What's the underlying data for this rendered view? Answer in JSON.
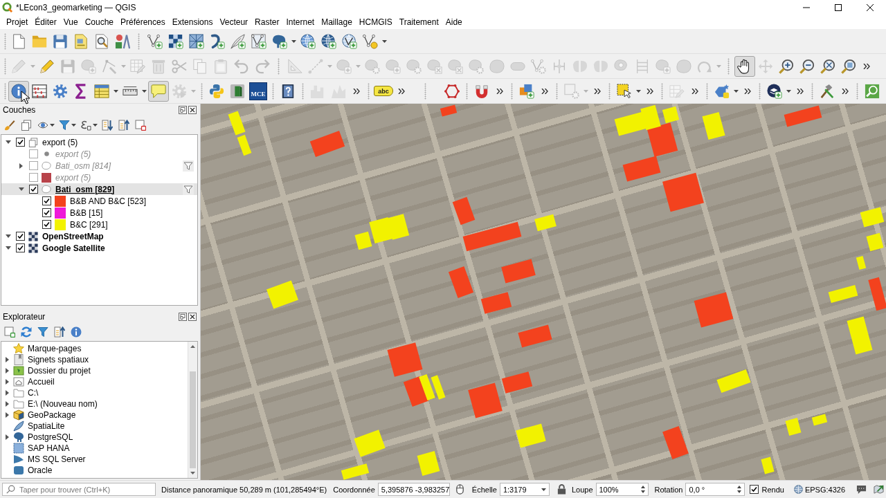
{
  "window": {
    "title": "*LEcon3_geomarketing — QGIS"
  },
  "menu": [
    "Projet",
    "Éditer",
    "Vue",
    "Couche",
    "Préférences",
    "Extensions",
    "Vecteur",
    "Raster",
    "Internet",
    "Maillage",
    "HCMGIS",
    "Traitement",
    "Aide"
  ],
  "toolbars": [
    {
      "buttons": [
        {
          "disabled": false,
          "pressed": false
        },
        {
          "disabled": false,
          "pressed": false
        },
        {
          "disabled": false,
          "pressed": false
        },
        {
          "disabled": false,
          "pressed": false
        },
        {
          "disabled": false,
          "pressed": false
        },
        {
          "disabled": false,
          "pressed": false
        },
        {
          "disabled": false,
          "pressed": false
        },
        {
          "disabled": false,
          "pressed": false
        },
        {
          "disabled": false,
          "pressed": false
        },
        {
          "disabled": false,
          "pressed": false
        },
        {
          "disabled": false,
          "pressed": false
        },
        {
          "disabled": false,
          "pressed": false
        },
        {
          "disabled": false,
          "pressed": false
        },
        {
          "disabled": false,
          "pressed": false
        },
        {
          "disabled": false,
          "pressed": false
        },
        {
          "disabled": false,
          "pressed": false
        },
        {
          "disabled": false,
          "pressed": false
        }
      ]
    },
    {
      "buttons": [
        {
          "disabled": true,
          "pressed": false
        },
        {
          "disabled": false,
          "pressed": false
        },
        {
          "disabled": true,
          "pressed": false
        },
        {
          "disabled": true,
          "pressed": false
        },
        {
          "disabled": true,
          "pressed": false
        },
        {
          "disabled": true,
          "pressed": false
        },
        {
          "disabled": true,
          "pressed": false
        },
        {
          "disabled": true,
          "pressed": false
        },
        {
          "disabled": true,
          "pressed": false
        },
        {
          "disabled": true,
          "pressed": false
        },
        {
          "disabled": true,
          "pressed": false
        },
        {
          "disabled": true,
          "pressed": false
        },
        {
          "disabled": true,
          "pressed": false
        },
        {
          "disabled": true,
          "pressed": false
        },
        {
          "disabled": true,
          "pressed": false
        },
        {
          "disabled": true,
          "pressed": false
        },
        {
          "disabled": true,
          "pressed": false
        },
        {
          "disabled": true,
          "pressed": false
        },
        {
          "disabled": true,
          "pressed": false
        },
        {
          "disabled": true,
          "pressed": false
        },
        {
          "disabled": true,
          "pressed": false
        },
        {
          "disabled": true,
          "pressed": false
        },
        {
          "disabled": true,
          "pressed": false
        },
        {
          "disabled": true,
          "pressed": false
        },
        {
          "disabled": true,
          "pressed": false
        },
        {
          "disabled": true,
          "pressed": false
        },
        {
          "disabled": true,
          "pressed": false
        },
        {
          "disabled": true,
          "pressed": false
        },
        {
          "disabled": true,
          "pressed": false
        },
        {
          "disabled": true,
          "pressed": false
        },
        {
          "disabled": true,
          "pressed": false
        },
        {
          "disabled": true,
          "pressed": false
        },
        {
          "disabled": false,
          "pressed": true
        },
        {
          "disabled": true,
          "pressed": false
        },
        {
          "disabled": false,
          "pressed": false
        },
        {
          "disabled": false,
          "pressed": false
        },
        {
          "disabled": false,
          "pressed": false
        },
        {
          "disabled": false,
          "pressed": false
        }
      ]
    },
    {
      "buttons": [
        {
          "disabled": false,
          "pressed": true
        },
        {
          "disabled": false,
          "pressed": false
        },
        {
          "disabled": false,
          "pressed": false
        },
        {
          "disabled": false,
          "pressed": false
        },
        {
          "disabled": false,
          "pressed": false
        },
        {
          "disabled": false,
          "pressed": false
        },
        {
          "disabled": false,
          "pressed": true
        },
        {
          "disabled": true,
          "pressed": false
        },
        {
          "disabled": false,
          "pressed": false
        },
        {
          "disabled": false,
          "pressed": false
        },
        {
          "label": "MCE",
          "disabled": false,
          "pressed": false
        },
        {
          "disabled": false,
          "pressed": false
        },
        {
          "disabled": true,
          "pressed": false
        },
        {
          "disabled": true,
          "pressed": false
        },
        {
          "label": "abc",
          "disabled": false,
          "pressed": false
        },
        {
          "disabled": false,
          "pressed": false
        },
        {
          "disabled": false,
          "pressed": false
        },
        {
          "disabled": false,
          "pressed": false
        },
        {
          "disabled": true,
          "pressed": false
        },
        {
          "disabled": false,
          "pressed": false
        },
        {
          "disabled": true,
          "pressed": false
        },
        {
          "disabled": false,
          "pressed": false
        },
        {
          "disabled": false,
          "pressed": false
        },
        {
          "disabled": false,
          "pressed": false
        },
        {
          "disabled": false,
          "pressed": false
        }
      ]
    }
  ],
  "layers_panel": {
    "title": "Couches",
    "tree": [
      {
        "kind": "group",
        "label": "export (5)",
        "checked": true,
        "expanded": true,
        "selected": false,
        "filtered": false,
        "children": [
          {
            "kind": "point-layer",
            "label": "export (5)",
            "checked": false,
            "selected": false,
            "filtered": false
          },
          {
            "kind": "polygon-layer",
            "label": "Bati_osm [814]",
            "checked": false,
            "expanded": false,
            "selected": false,
            "filtered": true
          },
          {
            "kind": "symbol-layer",
            "label": "export (5)",
            "checked": false,
            "color": "#b8434a",
            "selected": false,
            "filtered": false
          },
          {
            "kind": "polygon-layer",
            "label": "Bati_osm [829]",
            "checked": true,
            "expanded": true,
            "selected": true,
            "filtered": true,
            "children": [
              {
                "kind": "category",
                "label": "B&B AND B&C [523]",
                "checked": true,
                "color": "#f3421e",
                "selected": false
              },
              {
                "kind": "category",
                "label": "B&B [15]",
                "checked": true,
                "color": "#ee1ad8",
                "selected": false
              },
              {
                "kind": "category",
                "label": "B&C [291]",
                "checked": true,
                "color": "#f2f200",
                "selected": false
              }
            ]
          }
        ]
      },
      {
        "kind": "raster-layer",
        "label": "OpenStreetMap",
        "checked": true,
        "expanded": true,
        "selected": false,
        "filtered": false
      },
      {
        "kind": "raster-layer",
        "label": "Google Satellite",
        "checked": true,
        "expanded": true,
        "selected": false,
        "filtered": false
      }
    ]
  },
  "browser_panel": {
    "title": "Explorateur",
    "items": [
      {
        "label": "Marque-pages"
      },
      {
        "label": "Signets spatiaux",
        "expanded": false
      },
      {
        "label": "Dossier du projet",
        "expanded": false
      },
      {
        "label": "Accueil",
        "expanded": false
      },
      {
        "label": "C:\\",
        "expanded": false
      },
      {
        "label": "E:\\ (Nouveau nom)",
        "expanded": false
      },
      {
        "label": "GeoPackage",
        "expanded": false
      },
      {
        "label": "SpatiaLite"
      },
      {
        "label": "PostgreSQL",
        "expanded": false
      },
      {
        "label": "SAP HANA"
      },
      {
        "label": "MS SQL Server"
      },
      {
        "label": "Oracle"
      }
    ]
  },
  "status_bar": {
    "search": {
      "placeholder": "Taper pour trouver (Ctrl+K)"
    },
    "message": "Distance panoramique 50,289 m (101,285494°E)",
    "coordinate": {
      "label": "Coordonnée",
      "value": "5,395876 -3,983257"
    },
    "scale": {
      "label": "Échelle",
      "value": "1:3179"
    },
    "magnifier": {
      "label": "Loupe",
      "value": "100%"
    },
    "rotation": {
      "label": "Rotation",
      "value": "0,0 °"
    },
    "render": {
      "label": "Rendu",
      "checked": true
    },
    "crs": "EPSG:4326"
  }
}
